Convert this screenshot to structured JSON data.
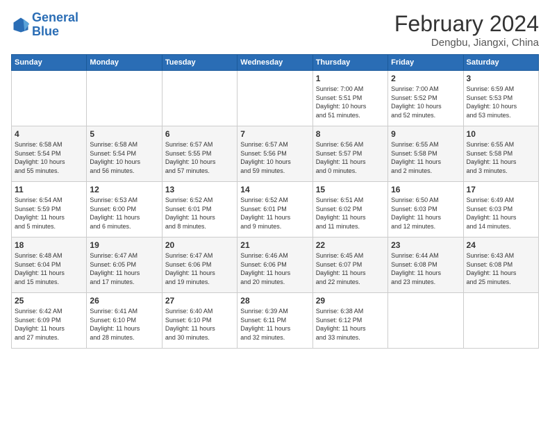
{
  "logo": {
    "line1": "General",
    "line2": "Blue"
  },
  "title": "February 2024",
  "location": "Dengbu, Jiangxi, China",
  "days_of_week": [
    "Sunday",
    "Monday",
    "Tuesday",
    "Wednesday",
    "Thursday",
    "Friday",
    "Saturday"
  ],
  "weeks": [
    [
      {
        "day": "",
        "info": ""
      },
      {
        "day": "",
        "info": ""
      },
      {
        "day": "",
        "info": ""
      },
      {
        "day": "",
        "info": ""
      },
      {
        "day": "1",
        "info": "Sunrise: 7:00 AM\nSunset: 5:51 PM\nDaylight: 10 hours\nand 51 minutes."
      },
      {
        "day": "2",
        "info": "Sunrise: 7:00 AM\nSunset: 5:52 PM\nDaylight: 10 hours\nand 52 minutes."
      },
      {
        "day": "3",
        "info": "Sunrise: 6:59 AM\nSunset: 5:53 PM\nDaylight: 10 hours\nand 53 minutes."
      }
    ],
    [
      {
        "day": "4",
        "info": "Sunrise: 6:58 AM\nSunset: 5:54 PM\nDaylight: 10 hours\nand 55 minutes."
      },
      {
        "day": "5",
        "info": "Sunrise: 6:58 AM\nSunset: 5:54 PM\nDaylight: 10 hours\nand 56 minutes."
      },
      {
        "day": "6",
        "info": "Sunrise: 6:57 AM\nSunset: 5:55 PM\nDaylight: 10 hours\nand 57 minutes."
      },
      {
        "day": "7",
        "info": "Sunrise: 6:57 AM\nSunset: 5:56 PM\nDaylight: 10 hours\nand 59 minutes."
      },
      {
        "day": "8",
        "info": "Sunrise: 6:56 AM\nSunset: 5:57 PM\nDaylight: 11 hours\nand 0 minutes."
      },
      {
        "day": "9",
        "info": "Sunrise: 6:55 AM\nSunset: 5:58 PM\nDaylight: 11 hours\nand 2 minutes."
      },
      {
        "day": "10",
        "info": "Sunrise: 6:55 AM\nSunset: 5:58 PM\nDaylight: 11 hours\nand 3 minutes."
      }
    ],
    [
      {
        "day": "11",
        "info": "Sunrise: 6:54 AM\nSunset: 5:59 PM\nDaylight: 11 hours\nand 5 minutes."
      },
      {
        "day": "12",
        "info": "Sunrise: 6:53 AM\nSunset: 6:00 PM\nDaylight: 11 hours\nand 6 minutes."
      },
      {
        "day": "13",
        "info": "Sunrise: 6:52 AM\nSunset: 6:01 PM\nDaylight: 11 hours\nand 8 minutes."
      },
      {
        "day": "14",
        "info": "Sunrise: 6:52 AM\nSunset: 6:01 PM\nDaylight: 11 hours\nand 9 minutes."
      },
      {
        "day": "15",
        "info": "Sunrise: 6:51 AM\nSunset: 6:02 PM\nDaylight: 11 hours\nand 11 minutes."
      },
      {
        "day": "16",
        "info": "Sunrise: 6:50 AM\nSunset: 6:03 PM\nDaylight: 11 hours\nand 12 minutes."
      },
      {
        "day": "17",
        "info": "Sunrise: 6:49 AM\nSunset: 6:03 PM\nDaylight: 11 hours\nand 14 minutes."
      }
    ],
    [
      {
        "day": "18",
        "info": "Sunrise: 6:48 AM\nSunset: 6:04 PM\nDaylight: 11 hours\nand 15 minutes."
      },
      {
        "day": "19",
        "info": "Sunrise: 6:47 AM\nSunset: 6:05 PM\nDaylight: 11 hours\nand 17 minutes."
      },
      {
        "day": "20",
        "info": "Sunrise: 6:47 AM\nSunset: 6:06 PM\nDaylight: 11 hours\nand 19 minutes."
      },
      {
        "day": "21",
        "info": "Sunrise: 6:46 AM\nSunset: 6:06 PM\nDaylight: 11 hours\nand 20 minutes."
      },
      {
        "day": "22",
        "info": "Sunrise: 6:45 AM\nSunset: 6:07 PM\nDaylight: 11 hours\nand 22 minutes."
      },
      {
        "day": "23",
        "info": "Sunrise: 6:44 AM\nSunset: 6:08 PM\nDaylight: 11 hours\nand 23 minutes."
      },
      {
        "day": "24",
        "info": "Sunrise: 6:43 AM\nSunset: 6:08 PM\nDaylight: 11 hours\nand 25 minutes."
      }
    ],
    [
      {
        "day": "25",
        "info": "Sunrise: 6:42 AM\nSunset: 6:09 PM\nDaylight: 11 hours\nand 27 minutes."
      },
      {
        "day": "26",
        "info": "Sunrise: 6:41 AM\nSunset: 6:10 PM\nDaylight: 11 hours\nand 28 minutes."
      },
      {
        "day": "27",
        "info": "Sunrise: 6:40 AM\nSunset: 6:10 PM\nDaylight: 11 hours\nand 30 minutes."
      },
      {
        "day": "28",
        "info": "Sunrise: 6:39 AM\nSunset: 6:11 PM\nDaylight: 11 hours\nand 32 minutes."
      },
      {
        "day": "29",
        "info": "Sunrise: 6:38 AM\nSunset: 6:12 PM\nDaylight: 11 hours\nand 33 minutes."
      },
      {
        "day": "",
        "info": ""
      },
      {
        "day": "",
        "info": ""
      }
    ]
  ]
}
